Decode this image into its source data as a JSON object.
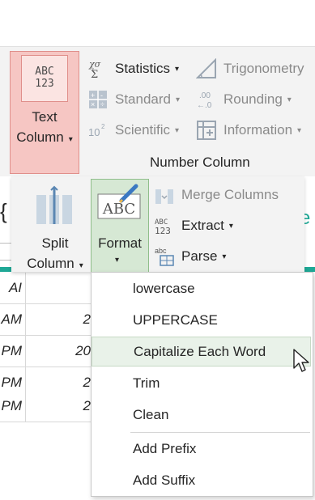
{
  "number_column": {
    "text_column": {
      "icon_text_top": "ABC",
      "icon_text_bottom": "123",
      "label_line1": "Text",
      "label_line2": "Column"
    },
    "items": [
      {
        "label": "Statistics",
        "icon_text": "Χσ Σ",
        "enabled": true
      },
      {
        "label": "Standard",
        "icon": "standard-ops-icon",
        "enabled": false
      },
      {
        "label": "Scientific",
        "icon_text": "10²",
        "enabled": false
      },
      {
        "label": "Trigonometry",
        "icon": "triangle-icon",
        "enabled": false
      },
      {
        "label": "Rounding",
        "icon_text": ".00 ←.0",
        "enabled": false
      },
      {
        "label": "Information",
        "icon": "information-grid-icon",
        "enabled": false
      }
    ],
    "group_label": "Number Column"
  },
  "text_column": {
    "split_column": {
      "line1": "Split",
      "line2": "Column"
    },
    "format": {
      "label": "Format",
      "icon_text": "ABC"
    },
    "merge_columns": "Merge Columns",
    "extract": {
      "label": "Extract",
      "icon_text_top": "ABC",
      "icon_text_bottom": "123"
    },
    "parse": {
      "label": "Parse",
      "icon_text": "abc"
    }
  },
  "grid": {
    "partial_left": "{",
    "partial_right": "e",
    "rows": [
      {
        "a": "AI",
        "b": ""
      },
      {
        "a": "AM",
        "b": "2"
      },
      {
        "a": "PM",
        "b": "20"
      },
      {
        "a": "PM",
        "b": "2"
      },
      {
        "a": "PM",
        "b": "2"
      }
    ]
  },
  "menu": {
    "items": [
      "lowercase",
      "UPPERCASE",
      "Capitalize Each Word",
      "Trim",
      "Clean",
      "Add Prefix",
      "Add Suffix"
    ],
    "hovered_index": 2
  },
  "colors": {
    "active_red": "#f6c6c3",
    "active_green": "#d6e8d4",
    "accent_teal": "#1fa896"
  }
}
